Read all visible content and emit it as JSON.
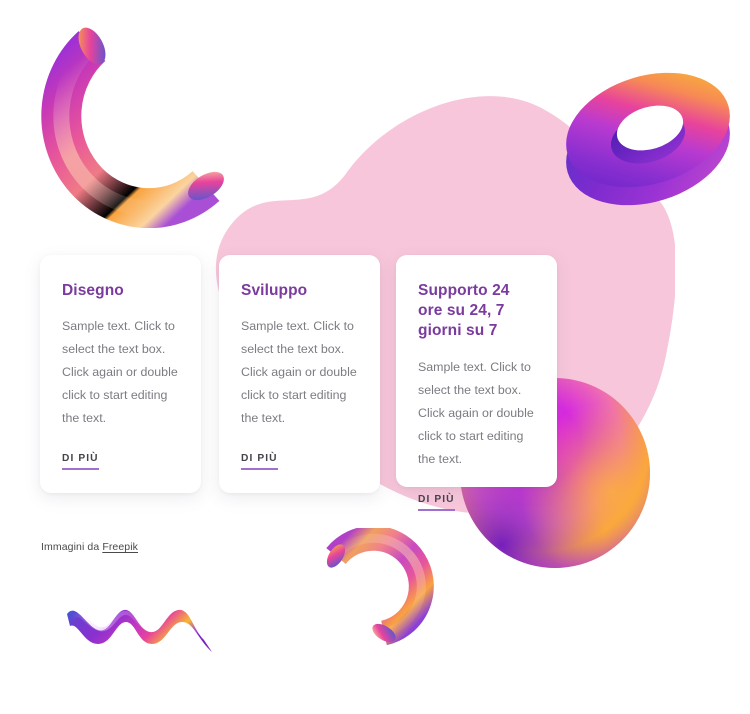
{
  "page": {
    "background_color": "#ffffff",
    "accent_purple": "#7a3a9e",
    "link_underline_color": "#a070d0",
    "blob_pink": "#f7c6da"
  },
  "cards": [
    {
      "title": "Disegno",
      "body": "Sample text. Click to select the text box. Click again or double click to start editing the text.",
      "link_label": "DI PIÙ"
    },
    {
      "title": "Sviluppo",
      "body": "Sample text. Click to select the text box. Click again or double click to start editing the text.",
      "link_label": "DI PIÙ"
    },
    {
      "title": "Supporto 24 ore su 24, 7 giorni su 7",
      "body": "Sample text. Click to select the text box. Click again or double click to start editing the text.",
      "link_label": "DI PIÙ"
    }
  ],
  "credit": {
    "prefix": "Immagini da ",
    "link_label": "Freepik"
  },
  "decorations": [
    {
      "name": "pink-organic-blob",
      "color": "#f7c6da"
    },
    {
      "name": "gradient-arc-tube-top-left",
      "colors": [
        "#8b2fd0",
        "#e0499a",
        "#f9a03c",
        "#3b5bdb"
      ]
    },
    {
      "name": "gradient-torus-top-right",
      "colors": [
        "#f7b733",
        "#e8439c",
        "#8b2fd0",
        "#5a32c8"
      ]
    },
    {
      "name": "gradient-sphere-blob-bottom-right",
      "colors": [
        "#d62ae0",
        "#f9a03c",
        "#7b22c8"
      ]
    },
    {
      "name": "gradient-arc-tube-bottom",
      "colors": [
        "#8b2fd0",
        "#e0499a",
        "#f9a03c",
        "#3b5bdb"
      ]
    },
    {
      "name": "gradient-wave-ribbon-bottom-left",
      "colors": [
        "#3b5bdb",
        "#8b2fd0",
        "#e8439c",
        "#f7b733"
      ]
    }
  ]
}
